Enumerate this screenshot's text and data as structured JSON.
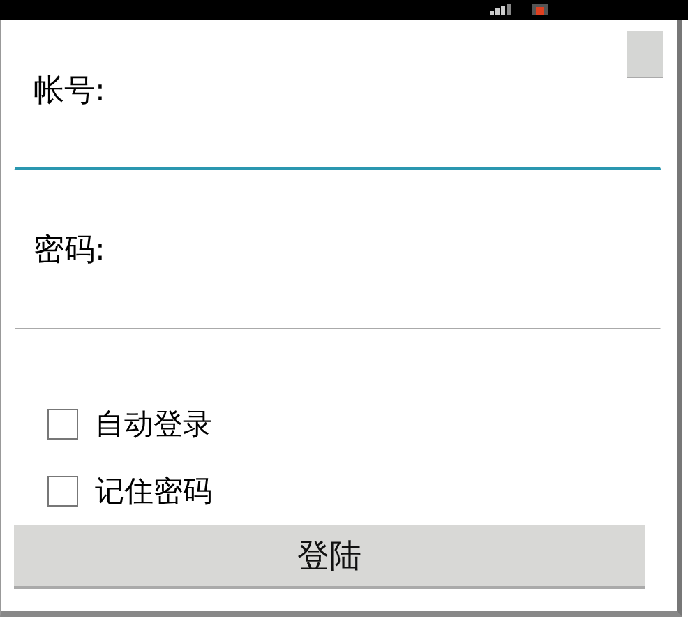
{
  "fields": [
    {
      "label": "帐号:",
      "focused": true
    },
    {
      "label": "密码:",
      "focused": false
    }
  ],
  "options": [
    {
      "label": "自动登录",
      "checked": false
    },
    {
      "label": "记住密码",
      "checked": false
    }
  ],
  "login_button": {
    "label": "登陆"
  }
}
